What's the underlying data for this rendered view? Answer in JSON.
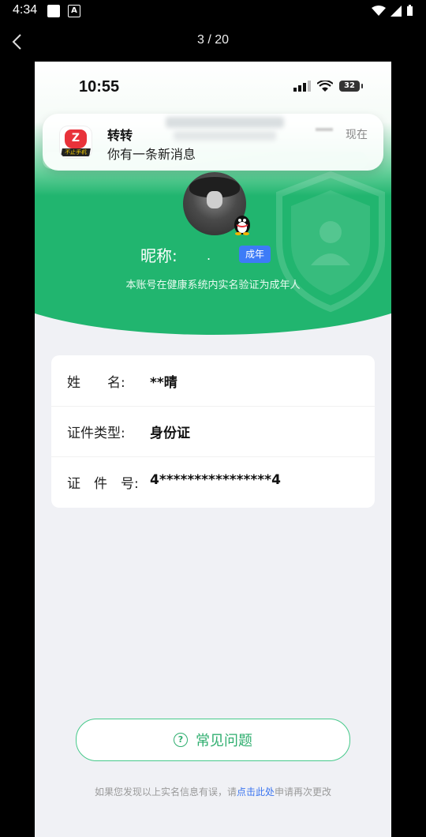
{
  "android_status": {
    "time": "4:34",
    "badge": "A"
  },
  "viewer": {
    "counter": "3 / 20"
  },
  "ios_status": {
    "time": "10:55",
    "battery": "32"
  },
  "notification": {
    "app": "转转",
    "message": "你有一条新消息",
    "time": "现在",
    "icon_tag": "不止手机"
  },
  "profile": {
    "nickname_label": "昵称:",
    "nickname_value": ".",
    "badge": "成年",
    "verified_text": "本账号在健康系统内实名验证为成年人"
  },
  "info_rows": [
    {
      "label": "姓　　名:",
      "value": "**晴"
    },
    {
      "label": "证件类型:",
      "value": "身份证"
    },
    {
      "label": "证　件　号:",
      "value": "4****************4"
    }
  ],
  "faq_button": "常见问题",
  "footer": {
    "prefix": "如果您发现以上实名信息有误，请",
    "link": "点击此处",
    "suffix": "申请再次更改"
  },
  "colors": {
    "brand_green": "#21b56f",
    "badge_blue": "#3d7bf7",
    "link_blue": "#3a74f0"
  }
}
